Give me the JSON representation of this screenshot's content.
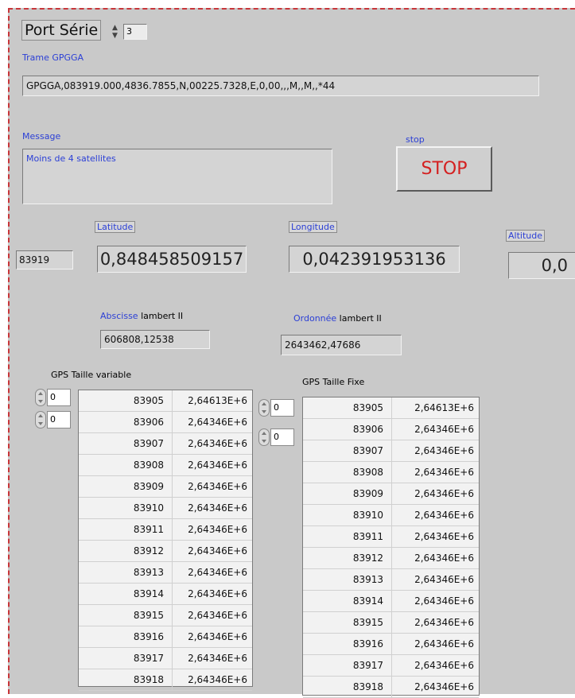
{
  "serial": {
    "label": "Port Série",
    "value": "3"
  },
  "trame": {
    "label": "Trame GPGGA",
    "value": "GPGGA,083919.000,4836.7855,N,00225.7328,E,0,00,,,M,,M,,*44"
  },
  "message": {
    "label": "Message",
    "value": "Moins de 4 satellites"
  },
  "stop": {
    "label": "stop",
    "button": "STOP"
  },
  "time_value": "83919",
  "latitude": {
    "label": "Latitude",
    "value": "0,848458509157"
  },
  "longitude": {
    "label": "Longitude",
    "value": "0,042391953136"
  },
  "altitude": {
    "label": "Altitude",
    "value": "0,0"
  },
  "abscisse": {
    "label_a": "Abscisse",
    "label_b": " lambert II",
    "value": "606808,12538"
  },
  "ordonnee": {
    "label_a": "Ordonnée",
    "label_b": " lambert II",
    "value": "2643462,47686"
  },
  "gps_var": {
    "label": "GPS Taille variable",
    "index_row": "0",
    "index_col": "0",
    "rows": [
      [
        "83905",
        "2,64613E+6"
      ],
      [
        "83906",
        "2,64346E+6"
      ],
      [
        "83907",
        "2,64346E+6"
      ],
      [
        "83908",
        "2,64346E+6"
      ],
      [
        "83909",
        "2,64346E+6"
      ],
      [
        "83910",
        "2,64346E+6"
      ],
      [
        "83911",
        "2,64346E+6"
      ],
      [
        "83912",
        "2,64346E+6"
      ],
      [
        "83913",
        "2,64346E+6"
      ],
      [
        "83914",
        "2,64346E+6"
      ],
      [
        "83915",
        "2,64346E+6"
      ],
      [
        "83916",
        "2,64346E+6"
      ],
      [
        "83917",
        "2,64346E+6"
      ],
      [
        "83918",
        "2,64346E+6"
      ]
    ]
  },
  "gps_fix": {
    "label": "GPS Taille Fixe",
    "index_row": "0",
    "index_col": "0",
    "rows": [
      [
        "83905",
        "2,64613E+6"
      ],
      [
        "83906",
        "2,64346E+6"
      ],
      [
        "83907",
        "2,64346E+6"
      ],
      [
        "83908",
        "2,64346E+6"
      ],
      [
        "83909",
        "2,64346E+6"
      ],
      [
        "83910",
        "2,64346E+6"
      ],
      [
        "83911",
        "2,64346E+6"
      ],
      [
        "83912",
        "2,64346E+6"
      ],
      [
        "83913",
        "2,64346E+6"
      ],
      [
        "83914",
        "2,64346E+6"
      ],
      [
        "83915",
        "2,64346E+6"
      ],
      [
        "83916",
        "2,64346E+6"
      ],
      [
        "83917",
        "2,64346E+6"
      ],
      [
        "83918",
        "2,64346E+6"
      ]
    ]
  }
}
